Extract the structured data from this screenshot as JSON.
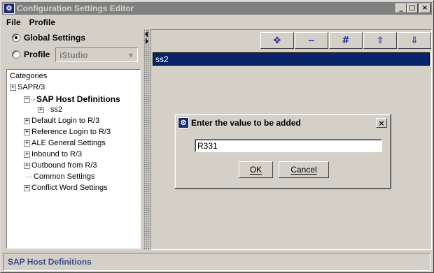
{
  "window": {
    "title": "Configuration Settings Editor",
    "minimize_glyph": "_",
    "maximize_glyph": "□",
    "close_glyph": "×"
  },
  "menu": {
    "items": [
      {
        "label": "File"
      },
      {
        "label": "Profile"
      }
    ]
  },
  "left": {
    "global_label": "Global Settings",
    "profile_label": "Profile",
    "profile_value": "iStudio",
    "selected_scope": "Global Settings"
  },
  "tree": {
    "header": "Categories",
    "nodes": [
      {
        "label": "SAPR/3",
        "expander": "+"
      },
      {
        "label": "SAP Host Definitions",
        "expander": "−"
      },
      {
        "label": "ss2",
        "expander": "+"
      },
      {
        "label": "Default Login to R/3",
        "expander": "+"
      },
      {
        "label": "Reference Login to R/3",
        "expander": "+"
      },
      {
        "label": "ALE General Settings",
        "expander": "+"
      },
      {
        "label": "Inbound to R/3",
        "expander": "+"
      },
      {
        "label": "Outbound from R/3",
        "expander": "+"
      },
      {
        "label": "Common Settings",
        "expander": ""
      },
      {
        "label": "Conflict Word Settings",
        "expander": "+"
      }
    ]
  },
  "toolbar": {
    "buttons": [
      {
        "icon": "add-icon",
        "glyph": "✥"
      },
      {
        "icon": "remove-icon",
        "glyph": "−"
      },
      {
        "icon": "edit-icon",
        "glyph": "#"
      },
      {
        "icon": "move-up-icon",
        "glyph": "⇧"
      },
      {
        "icon": "move-down-icon",
        "glyph": "⇩"
      }
    ]
  },
  "list": {
    "rows": [
      "ss2"
    ]
  },
  "status": {
    "text": "SAP Host Definitions"
  },
  "dialog": {
    "title": "Enter the value to be added",
    "close_glyph": "×",
    "input_value": "R331",
    "ok_label": "OK",
    "cancel_label": "Cancel"
  },
  "colors": {
    "selection": "#0a246a",
    "titlebar_inactive": "#808080",
    "status_text": "#3a4a8c"
  }
}
